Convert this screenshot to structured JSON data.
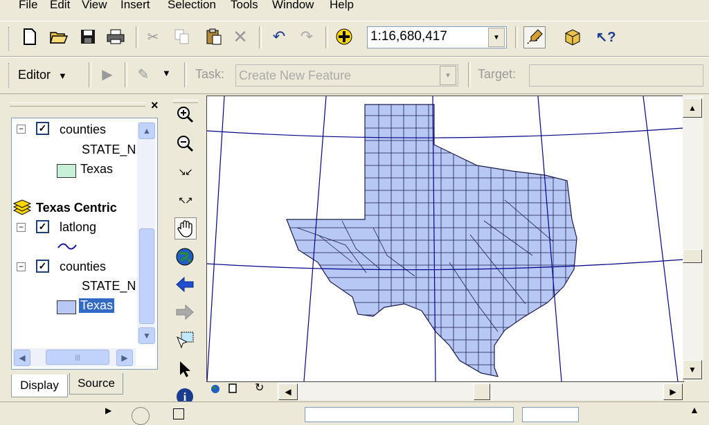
{
  "menu": {
    "file": "File",
    "edit": "Edit",
    "view": "View",
    "insert": "Insert",
    "selection": "Selection",
    "tools": "Tools",
    "window": "Window",
    "help": "Help"
  },
  "standard_toolbar": {
    "scale": "1:16,680,417"
  },
  "editor_toolbar": {
    "editor_label": "Editor",
    "task_label": "Task:",
    "task_value": "Create New Feature",
    "target_label": "Target:",
    "target_value": ""
  },
  "toc": {
    "close_glyph": "×",
    "items": [
      {
        "type": "layer",
        "label": "counties",
        "checked": true
      },
      {
        "type": "field",
        "label": "STATE_N"
      },
      {
        "type": "symbol",
        "label": "Texas",
        "color": "#c8f0d8"
      },
      {
        "type": "dataframe",
        "label": "Texas Centric"
      },
      {
        "type": "layer",
        "label": "latlong",
        "checked": true
      },
      {
        "type": "layer",
        "label": "counties",
        "checked": true
      },
      {
        "type": "field",
        "label": "STATE_N"
      },
      {
        "type": "symbol",
        "label": "Texas",
        "color": "#b8c8f5",
        "selected": true
      }
    ],
    "tabs": {
      "display": "Display",
      "source": "Source"
    }
  },
  "map": {
    "fill_color": "#b8c8f5",
    "graticule_color": "#00008b",
    "outline_color": "#1a1a4a"
  },
  "colors": {
    "selection": "#316ac5",
    "panel": "#ece9d8"
  }
}
